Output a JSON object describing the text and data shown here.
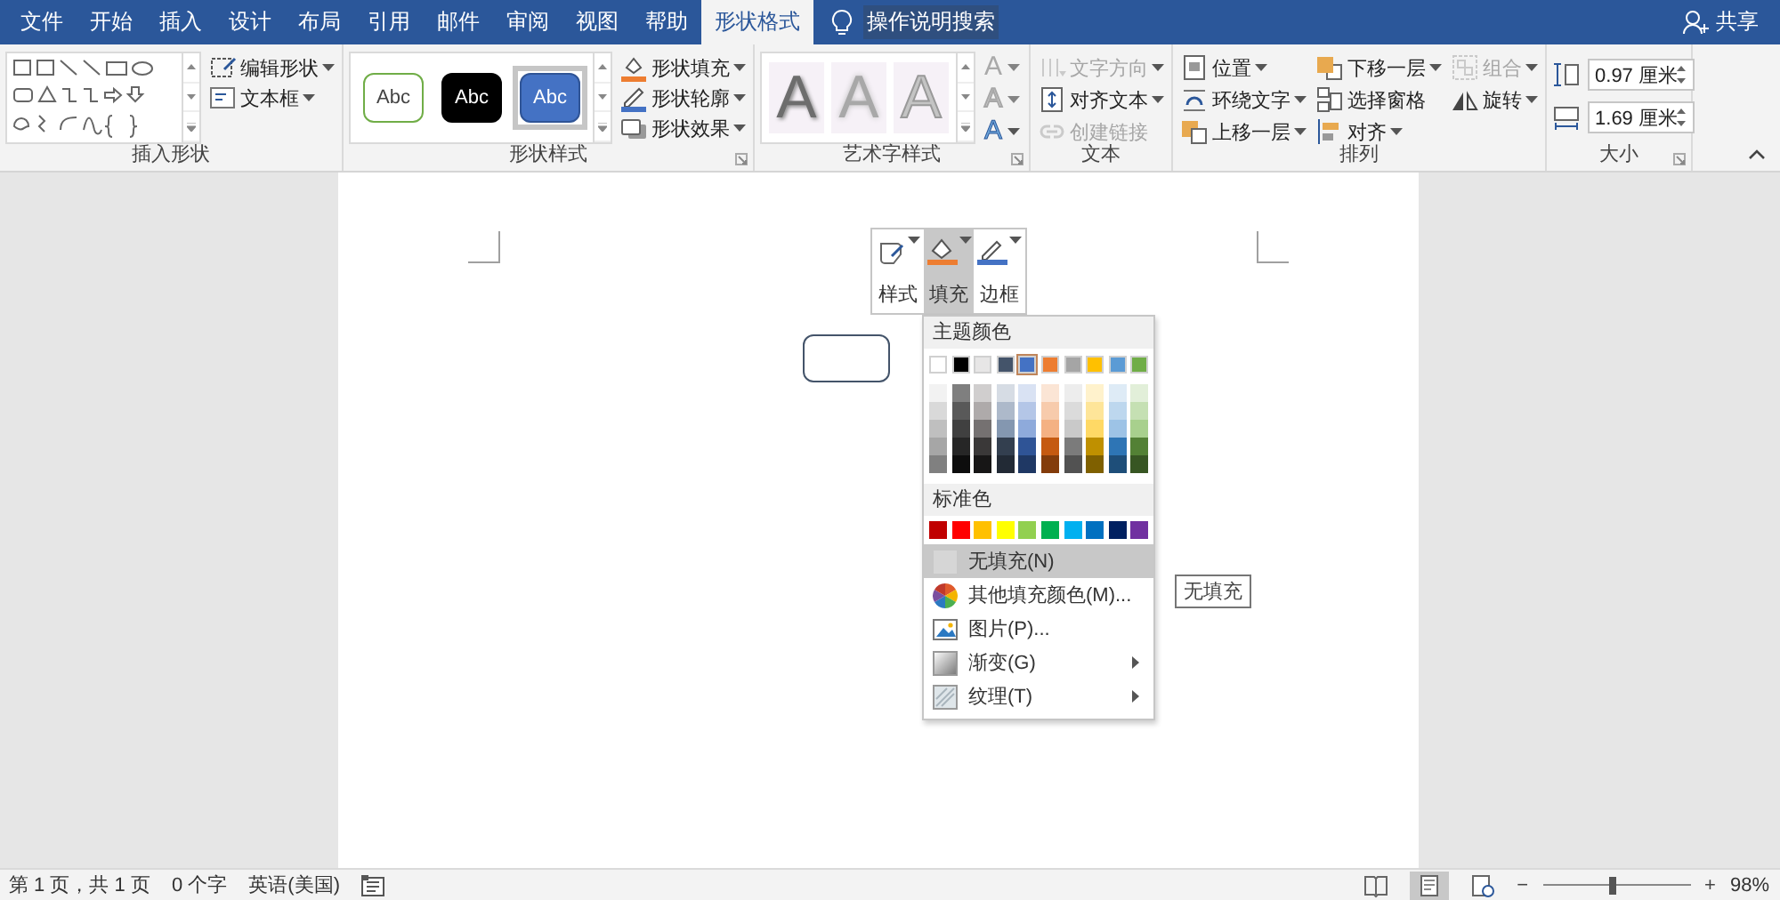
{
  "tabs": [
    {
      "label": "文件",
      "selected": false
    },
    {
      "label": "开始",
      "selected": false
    },
    {
      "label": "插入",
      "selected": false
    },
    {
      "label": "设计",
      "selected": false
    },
    {
      "label": "布局",
      "selected": false
    },
    {
      "label": "引用",
      "selected": false
    },
    {
      "label": "邮件",
      "selected": false
    },
    {
      "label": "审阅",
      "selected": false
    },
    {
      "label": "视图",
      "selected": false
    },
    {
      "label": "帮助",
      "selected": false
    },
    {
      "label": "形状格式",
      "selected": true
    }
  ],
  "search": {
    "label": "操作说明搜索"
  },
  "share": {
    "label": "共享"
  },
  "ribbon": {
    "groups": [
      {
        "kind": "insert_shapes",
        "label": "插入形状",
        "launcher": false,
        "commands": [
          {
            "label": "编辑形状",
            "kind": "edit_shape",
            "dropdown": true,
            "disabled": false
          },
          {
            "label": "文本框",
            "kind": "textbox",
            "dropdown": true,
            "disabled": false
          }
        ]
      },
      {
        "kind": "shape_styles",
        "label": "形状样式",
        "launcher": true,
        "presets": [
          {
            "label": "Abc",
            "kind": "outline",
            "selected": false
          },
          {
            "label": "Abc",
            "kind": "dark",
            "selected": false
          },
          {
            "label": "Abc",
            "kind": "accent",
            "selected": true
          }
        ],
        "commands": [
          {
            "label": "形状填充",
            "kind": "fill",
            "dropdown": true,
            "disabled": false
          },
          {
            "label": "形状轮廓",
            "kind": "outline",
            "dropdown": true,
            "disabled": false
          },
          {
            "label": "形状效果",
            "kind": "effects",
            "dropdown": true,
            "disabled": false
          }
        ]
      },
      {
        "kind": "wordart",
        "label": "艺术字样式",
        "launcher": true,
        "presets": [
          {
            "label": "A",
            "kind": "shadow"
          },
          {
            "label": "A",
            "kind": "soft"
          },
          {
            "label": "A",
            "kind": "outline"
          }
        ],
        "side": [
          {
            "label": "A",
            "kind": "fill",
            "disabled": true
          },
          {
            "label": "A",
            "kind": "outline",
            "disabled": true
          },
          {
            "label": "A",
            "kind": "effects",
            "disabled": false
          }
        ]
      },
      {
        "kind": "text",
        "label": "文本",
        "launcher": false,
        "commands": [
          {
            "label": "文字方向",
            "kind": "text_direction",
            "dropdown": true,
            "disabled": true
          },
          {
            "label": "对齐文本",
            "kind": "align_text",
            "dropdown": true,
            "disabled": false
          },
          {
            "label": "创建链接",
            "kind": "link",
            "dropdown": false,
            "disabled": true
          }
        ]
      },
      {
        "kind": "arrange",
        "label": "排列",
        "launcher": false,
        "columns": [
          [
            {
              "label": "位置",
              "kind": "position",
              "dropdown": true,
              "disabled": false
            },
            {
              "label": "环绕文字",
              "kind": "wrap",
              "dropdown": true,
              "disabled": false
            },
            {
              "label": "上移一层",
              "kind": "forward",
              "dropdown": true,
              "disabled": false
            }
          ],
          [
            {
              "label": "下移一层",
              "kind": "backward",
              "dropdown": true,
              "disabled": false
            },
            {
              "label": "选择窗格",
              "kind": "pane",
              "dropdown": false,
              "disabled": false
            },
            {
              "label": "对齐",
              "kind": "align",
              "dropdown": true,
              "disabled": false
            }
          ],
          [
            {
              "label": "组合",
              "kind": "group",
              "dropdown": true,
              "disabled": true
            },
            {
              "label": "旋转",
              "kind": "rotate",
              "dropdown": true,
              "disabled": false
            }
          ]
        ]
      },
      {
        "kind": "size",
        "label": "大小",
        "launcher": true,
        "fields": [
          {
            "kind": "height",
            "value": "0.97 厘米"
          },
          {
            "kind": "width",
            "value": "1.69 厘米"
          }
        ]
      }
    ]
  },
  "document": {
    "mini_toolbar": [
      {
        "label": "样式",
        "kind": "style",
        "selected": false
      },
      {
        "label": "填充",
        "kind": "fill",
        "selected": true
      },
      {
        "label": "边框",
        "kind": "border",
        "selected": false
      }
    ],
    "fill_menu": {
      "theme_heading": "主题颜色",
      "theme_colors": [
        {
          "color": "#ffffff",
          "selected": false,
          "shades": [
            {
              "color": "#f2f2f2"
            },
            {
              "color": "#d9d9d9"
            },
            {
              "color": "#bfbfbf"
            },
            {
              "color": "#a6a6a6"
            },
            {
              "color": "#808080"
            }
          ]
        },
        {
          "color": "#000000",
          "selected": false,
          "shades": [
            {
              "color": "#7f7f7f"
            },
            {
              "color": "#595959"
            },
            {
              "color": "#404040"
            },
            {
              "color": "#262626"
            },
            {
              "color": "#0d0d0d"
            }
          ]
        },
        {
          "color": "#e7e6e6",
          "selected": false,
          "shades": [
            {
              "color": "#d0cece"
            },
            {
              "color": "#aeaaaa"
            },
            {
              "color": "#757171"
            },
            {
              "color": "#3a3838"
            },
            {
              "color": "#171616"
            }
          ]
        },
        {
          "color": "#44546a",
          "selected": false,
          "shades": [
            {
              "color": "#d6dce4"
            },
            {
              "color": "#adb9ca"
            },
            {
              "color": "#8497b0"
            },
            {
              "color": "#333f4f"
            },
            {
              "color": "#222a35"
            }
          ]
        },
        {
          "color": "#4472c4",
          "selected": true,
          "shades": [
            {
              "color": "#d9e2f3"
            },
            {
              "color": "#b4c6e7"
            },
            {
              "color": "#8eaadb"
            },
            {
              "color": "#2f5496"
            },
            {
              "color": "#1f3864"
            }
          ]
        },
        {
          "color": "#ed7d31",
          "selected": false,
          "shades": [
            {
              "color": "#fbe5d5"
            },
            {
              "color": "#f7cbac"
            },
            {
              "color": "#f4b183"
            },
            {
              "color": "#c55a11"
            },
            {
              "color": "#833c0b"
            }
          ]
        },
        {
          "color": "#a5a5a5",
          "selected": false,
          "shades": [
            {
              "color": "#ededed"
            },
            {
              "color": "#dbdbdb"
            },
            {
              "color": "#c9c9c9"
            },
            {
              "color": "#7b7b7b"
            },
            {
              "color": "#525252"
            }
          ]
        },
        {
          "color": "#ffc000",
          "selected": false,
          "shades": [
            {
              "color": "#fff2cc"
            },
            {
              "color": "#fee599"
            },
            {
              "color": "#ffd965"
            },
            {
              "color": "#bf9000"
            },
            {
              "color": "#7f6000"
            }
          ]
        },
        {
          "color": "#5b9bd5",
          "selected": false,
          "shades": [
            {
              "color": "#deebf6"
            },
            {
              "color": "#bdd7ee"
            },
            {
              "color": "#9dc3e6"
            },
            {
              "color": "#2e75b5"
            },
            {
              "color": "#1e4e79"
            }
          ]
        },
        {
          "color": "#70ad47",
          "selected": false,
          "shades": [
            {
              "color": "#e2efd9"
            },
            {
              "color": "#c5e0b3"
            },
            {
              "color": "#a8d08d"
            },
            {
              "color": "#538135"
            },
            {
              "color": "#375623"
            }
          ]
        }
      ],
      "standard_heading": "标准色",
      "standard_colors": [
        {
          "color": "#c00000"
        },
        {
          "color": "#ff0000"
        },
        {
          "color": "#ffc000"
        },
        {
          "color": "#ffff00"
        },
        {
          "color": "#92d050"
        },
        {
          "color": "#00b050"
        },
        {
          "color": "#00b0f0"
        },
        {
          "color": "#0070c0"
        },
        {
          "color": "#002060"
        },
        {
          "color": "#7030a0"
        }
      ],
      "items": [
        {
          "label": "无填充(N)",
          "kind": "none",
          "selected": true,
          "submenu": false
        },
        {
          "label": "其他填充颜色(M)...",
          "kind": "more",
          "selected": false,
          "submenu": false
        },
        {
          "label": "图片(P)...",
          "kind": "picture",
          "selected": false,
          "submenu": false
        },
        {
          "label": "渐变(G)",
          "kind": "gradient",
          "selected": false,
          "submenu": true
        },
        {
          "label": "纹理(T)",
          "kind": "texture",
          "selected": false,
          "submenu": true
        }
      ]
    },
    "tooltip": "无填充"
  },
  "status_bar": {
    "items": [
      "第 1 页，共 1 页",
      "0 个字",
      "英语(美国)"
    ],
    "views": [
      {
        "kind": "read",
        "selected": false
      },
      {
        "kind": "print",
        "selected": true
      },
      {
        "kind": "web",
        "selected": false
      }
    ],
    "zoom_out": "−",
    "zoom_in": "+",
    "zoom": {
      "level": 0.47,
      "label": "98%"
    }
  }
}
